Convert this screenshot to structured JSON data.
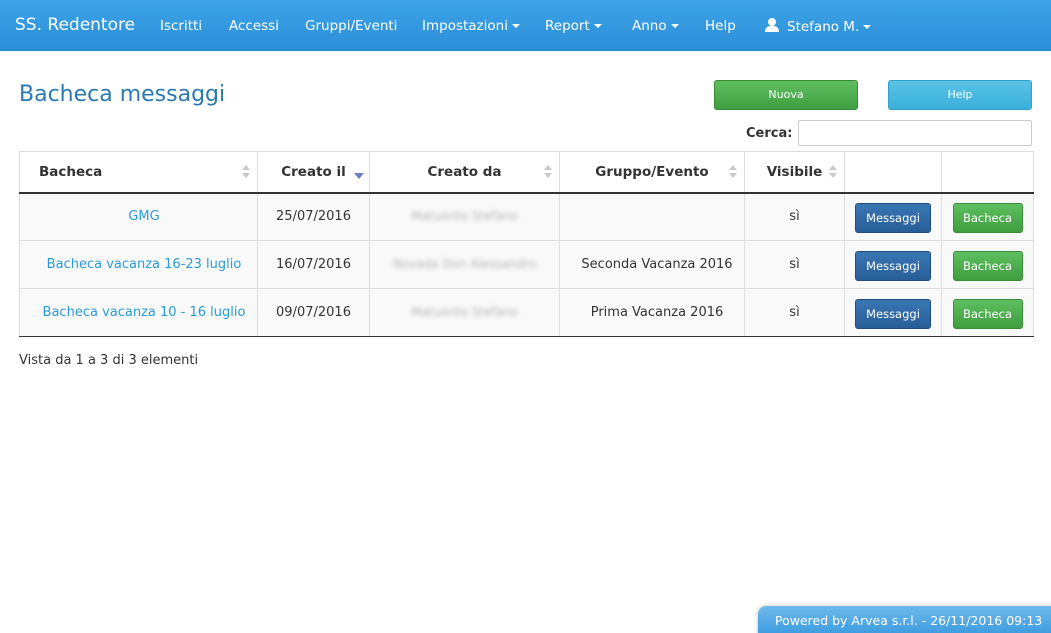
{
  "navbar": {
    "brand": "SS. Redentore",
    "items": [
      {
        "label": "Iscritti",
        "dropdown": false
      },
      {
        "label": "Accessi",
        "dropdown": false
      },
      {
        "label": "Gruppi/Eventi",
        "dropdown": false
      },
      {
        "label": "Impostazioni",
        "dropdown": true
      },
      {
        "label": "Report",
        "dropdown": true
      },
      {
        "label": "Anno",
        "dropdown": true
      },
      {
        "label": "Help",
        "dropdown": false
      }
    ],
    "user": {
      "label": "Stefano M.",
      "icon": "user-icon",
      "dropdown": true
    }
  },
  "page": {
    "title": "Bacheca messaggi",
    "buttons": {
      "new_label": "Nuova",
      "help_label": "Help"
    },
    "search": {
      "label": "Cerca:",
      "value": "",
      "placeholder": ""
    }
  },
  "table": {
    "columns": [
      {
        "label": "Bacheca",
        "sortable": true,
        "sorted": false
      },
      {
        "label": "Creato il",
        "sortable": true,
        "sorted": true,
        "direction": "desc"
      },
      {
        "label": "Creato da",
        "sortable": true,
        "sorted": false
      },
      {
        "label": "Gruppo/Evento",
        "sortable": true,
        "sorted": false
      },
      {
        "label": "Visibile",
        "sortable": true,
        "sorted": false
      },
      {
        "label": "",
        "sortable": false
      },
      {
        "label": "",
        "sortable": false
      }
    ],
    "rows": [
      {
        "bacheca": "GMG",
        "creato_il": "25/07/2016",
        "creato_da": "Matuonto Stefano",
        "gruppo": "",
        "visibile": "sì",
        "btn_messaggi": "Messaggi",
        "btn_bacheca": "Bacheca"
      },
      {
        "bacheca": "Bacheca vacanza 16-23 luglio",
        "creato_il": "16/07/2016",
        "creato_da": "Novada Don Alessandro",
        "gruppo": "Seconda Vacanza 2016",
        "visibile": "sì",
        "btn_messaggi": "Messaggi",
        "btn_bacheca": "Bacheca"
      },
      {
        "bacheca": "Bacheca vacanza 10 - 16 luglio",
        "creato_il": "09/07/2016",
        "creato_da": "Matuonto Stefano",
        "gruppo": "Prima Vacanza 2016",
        "visibile": "sì",
        "btn_messaggi": "Messaggi",
        "btn_bacheca": "Bacheca"
      }
    ],
    "info": "Vista da 1 a 3 di 3 elementi"
  },
  "footer": {
    "text": "Powered by Arvea s.r.l. - 26/11/2016 09:13"
  },
  "colors": {
    "navbar": "#3399dd",
    "title": "#2a7ab0",
    "link": "#2a9bd8",
    "success": "#4cae4c",
    "info": "#5bc0de",
    "primary": "#2e6da4"
  }
}
